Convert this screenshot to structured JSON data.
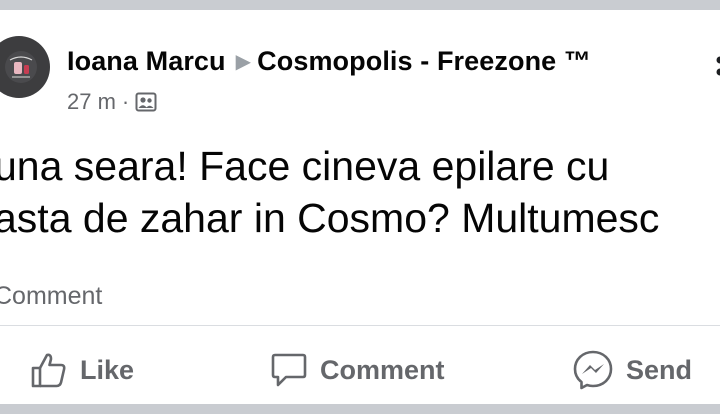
{
  "post": {
    "author": "Ioana Marcu",
    "group": "Cosmopolis - Freezone ™",
    "time": "27 m",
    "separator": "·",
    "text_line1": "una seara! Face cineva epilare cu",
    "text_line2": "asta de zahar in Cosmo? Multumesc",
    "comment_count": "Comment"
  },
  "actions": {
    "like_label": "Like",
    "comment_label": "Comment",
    "send_label": "Send"
  },
  "colors": {
    "text": "#050505",
    "secondary": "#65676b",
    "divider": "#dadde1",
    "background": "#c9ccd1"
  },
  "icons": [
    "avatar",
    "group-arrow-icon",
    "group-audience-icon",
    "more-options-icon",
    "like-icon",
    "comment-icon",
    "messenger-send-icon"
  ]
}
